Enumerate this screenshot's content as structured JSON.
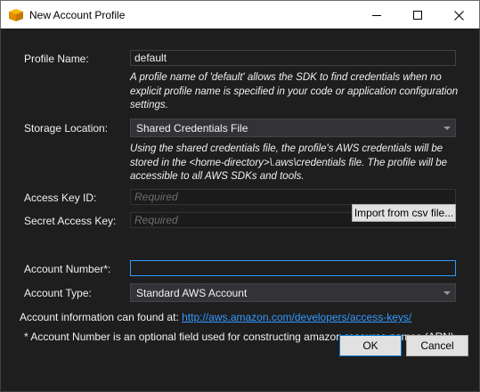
{
  "window": {
    "title": "New Account Profile",
    "controls": {
      "minimize": "minimize",
      "maximize": "maximize",
      "close": "close"
    }
  },
  "form": {
    "profile_name": {
      "label": "Profile Name:",
      "value": "default",
      "hint": "A profile name of 'default' allows the SDK to find credentials when no explicit profile name is specified in your code or application configuration settings."
    },
    "storage_location": {
      "label": "Storage Location:",
      "selected": "Shared Credentials File",
      "hint": "Using the shared credentials file, the profile's AWS credentials will be stored in the <home-directory>\\.aws\\credentials file. The profile will be accessible to all AWS SDKs and tools."
    },
    "access_key_id": {
      "label": "Access Key ID:",
      "placeholder": "Required"
    },
    "secret_access_key": {
      "label": "Secret Access Key:",
      "placeholder": "Required"
    },
    "import_button": "Import from csv file...",
    "account_number": {
      "label": "Account Number*:",
      "value": ""
    },
    "account_type": {
      "label": "Account Type:",
      "selected": "Standard AWS Account"
    }
  },
  "info": {
    "account_info_prefix": "Account information can found at:",
    "account_info_link": "http://aws.amazon.com/developers/access-keys/",
    "footnote": "* Account Number is an optional field used for constructing amazon resource names (ARN)."
  },
  "buttons": {
    "ok": "OK",
    "cancel": "Cancel"
  },
  "colors": {
    "background": "#1e1e1e",
    "link": "#3399ff",
    "focus_border": "#3399ff",
    "title_bar": "#ffffff"
  }
}
